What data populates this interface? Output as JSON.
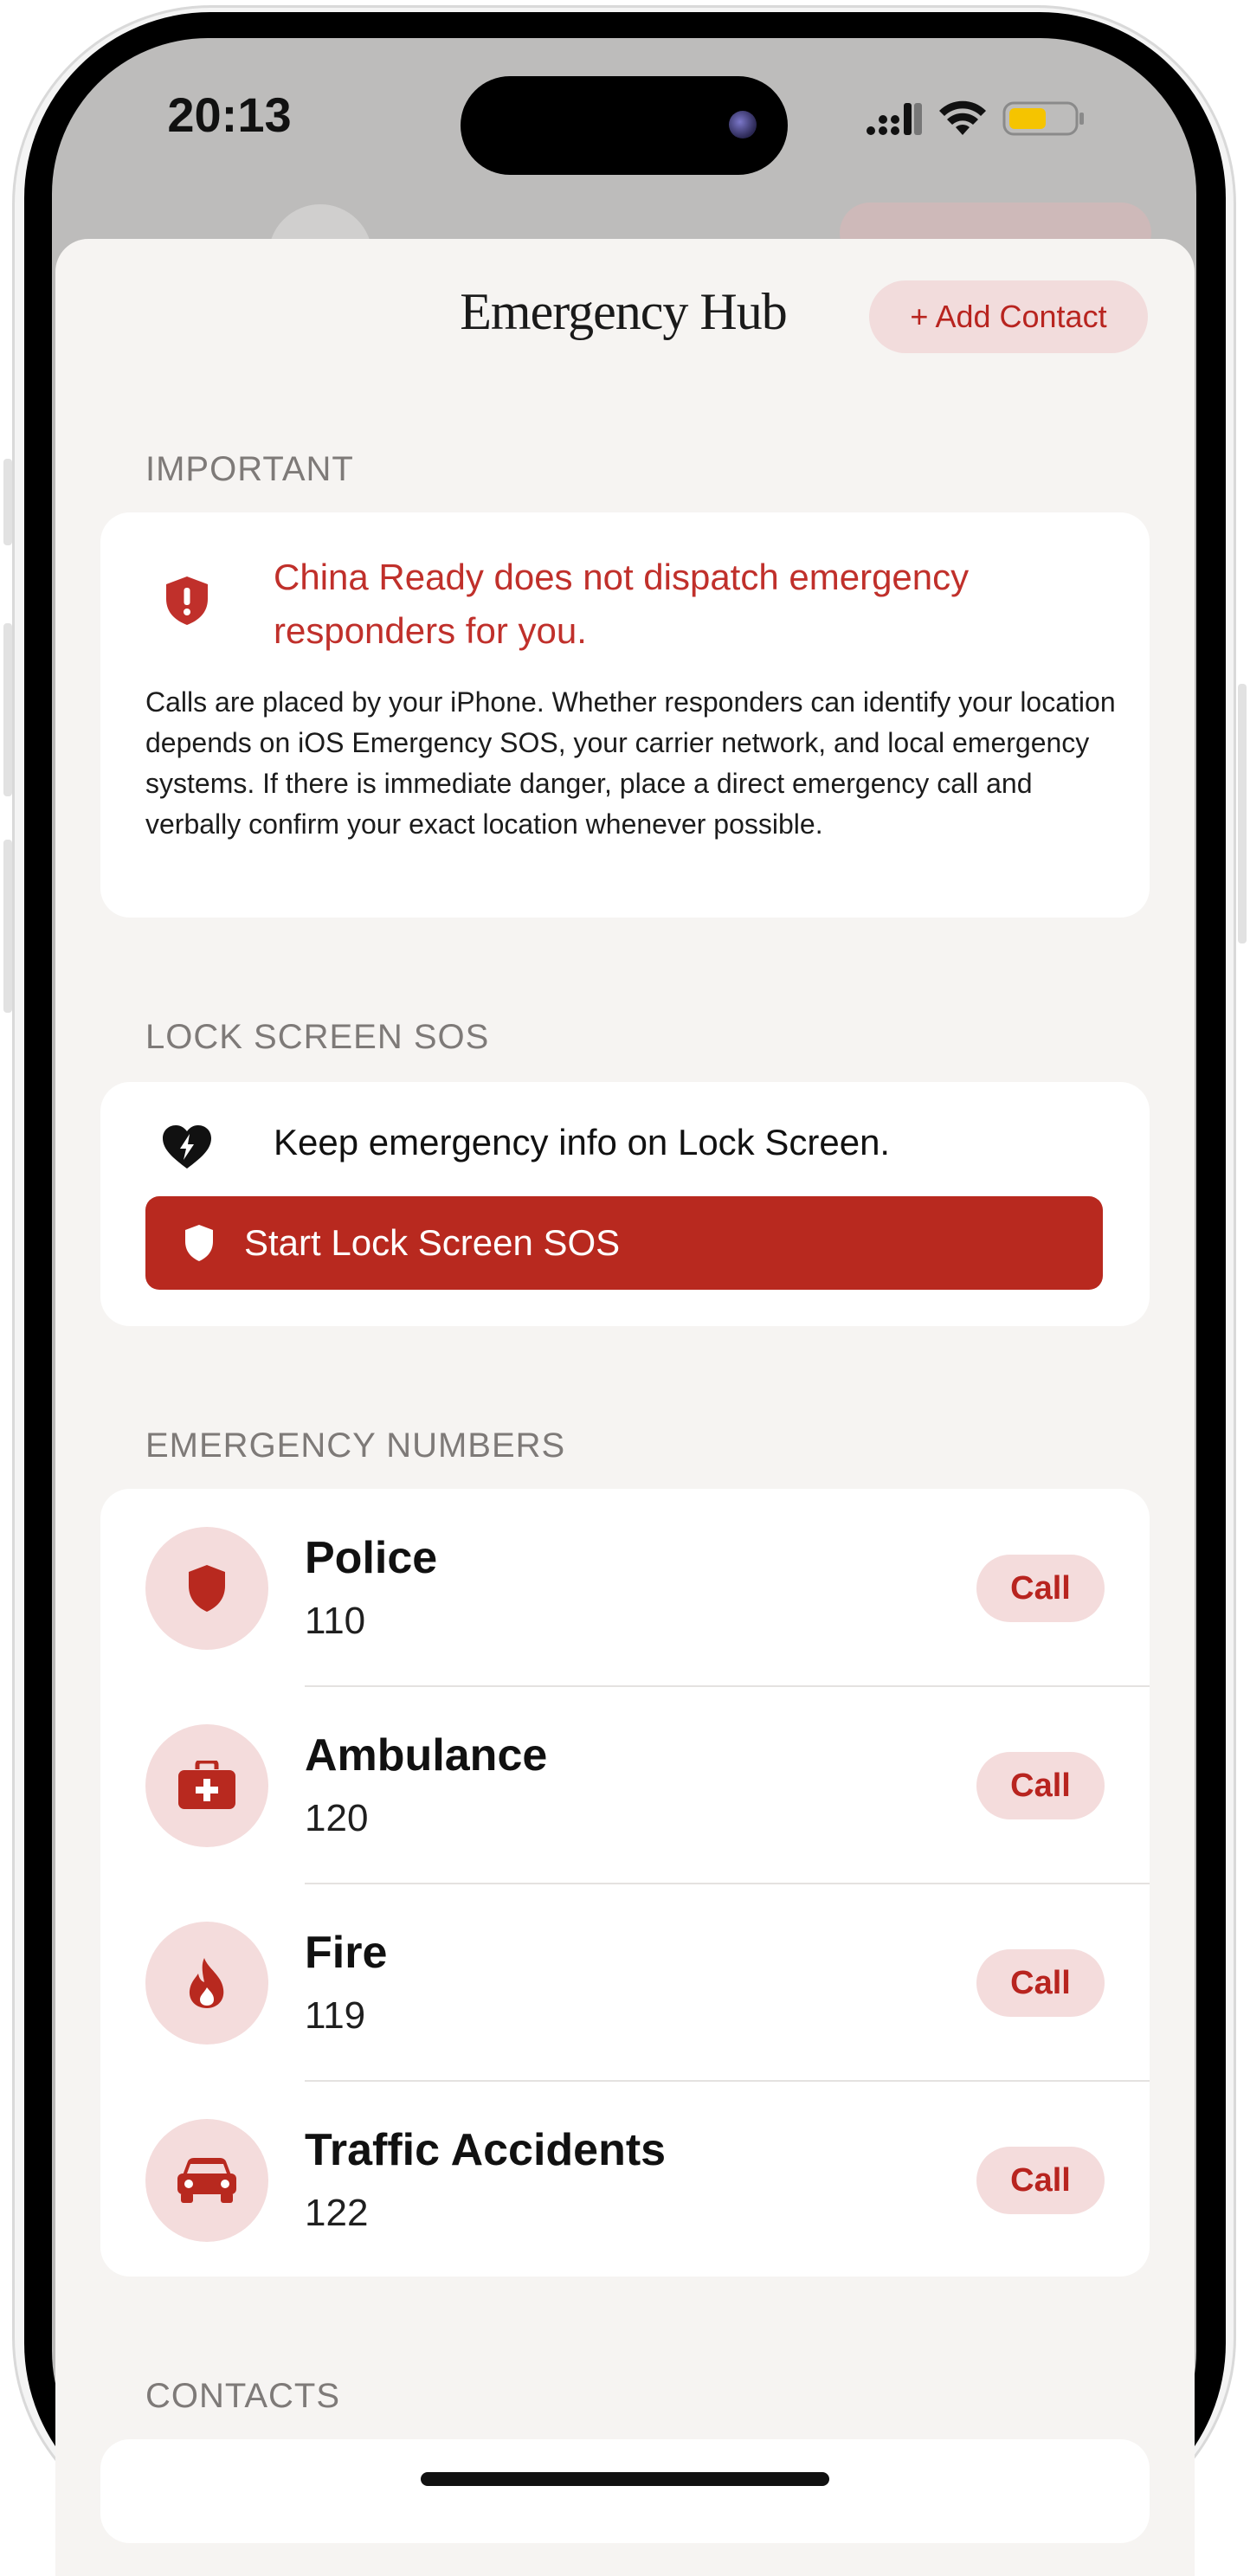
{
  "status_bar": {
    "time": "20:13"
  },
  "header": {
    "title": "Emergency Hub",
    "add_contact_label": "+ Add Contact"
  },
  "important": {
    "section_label": "IMPORTANT",
    "title": "China Ready does not dispatch emergency responders for you.",
    "body": "Calls are placed by your iPhone. Whether responders can identify your location depends on iOS Emergency SOS, your carrier network, and local emergency systems. If there is immediate danger, place a direct emergency call and verbally confirm your exact location whenever possible."
  },
  "lock_screen": {
    "section_label": "LOCK SCREEN SOS",
    "text": "Keep emergency info on Lock Screen.",
    "button_label": "Start Lock Screen SOS"
  },
  "emergency_numbers": {
    "section_label": "EMERGENCY NUMBERS",
    "items": [
      {
        "name": "Police",
        "number": "110",
        "icon": "shield-icon",
        "call_label": "Call"
      },
      {
        "name": "Ambulance",
        "number": "120",
        "icon": "medical-kit-icon",
        "call_label": "Call"
      },
      {
        "name": "Fire",
        "number": "119",
        "icon": "flame-icon",
        "call_label": "Call"
      },
      {
        "name": "Traffic Accidents",
        "number": "122",
        "icon": "car-icon",
        "call_label": "Call"
      }
    ]
  },
  "contacts": {
    "section_label": "CONTACTS"
  },
  "colors": {
    "accent": "#b8291f",
    "accent_soft": "#f4dcdc",
    "background": "#f6f4f2"
  }
}
